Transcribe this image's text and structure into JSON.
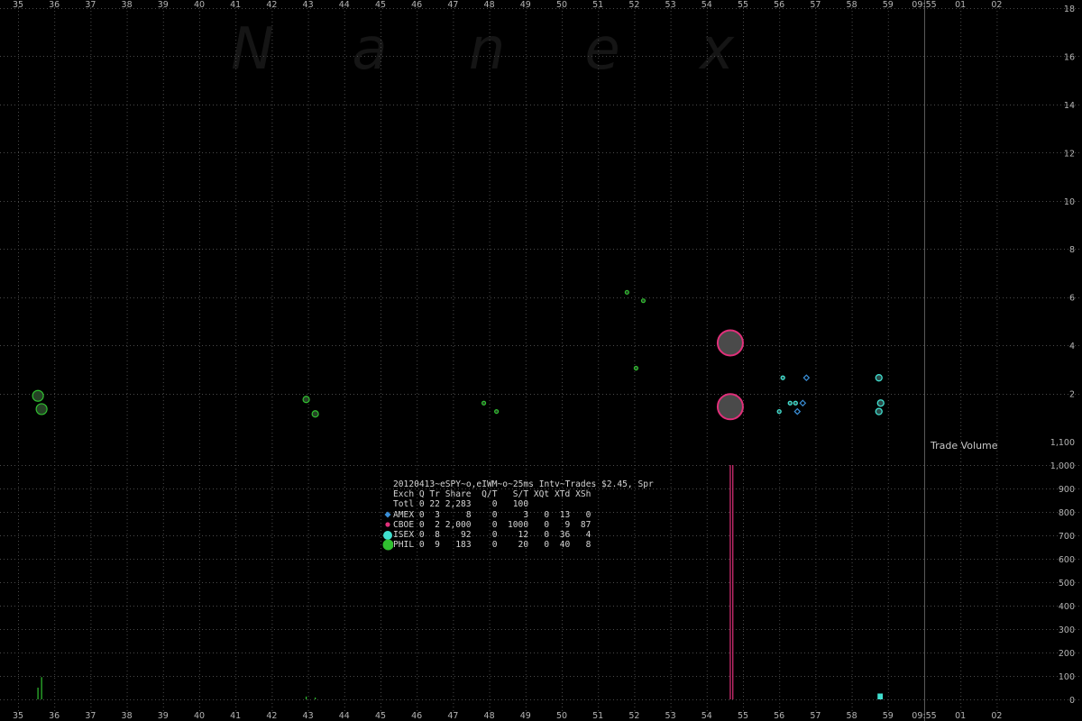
{
  "chart_data": {
    "type": "scatter",
    "title": "20120413~eSPY~o,eIWM~o~25ms Intv~Trades $2.45, Spr",
    "watermark": [
      "N",
      "a",
      "n",
      "e",
      "x"
    ],
    "x_axis": {
      "start_second": 34.5,
      "end_second": 122.5,
      "labels": [
        "35",
        "36",
        "37",
        "38",
        "39",
        "40",
        "41",
        "42",
        "43",
        "44",
        "45",
        "46",
        "47",
        "48",
        "49",
        "50",
        "51",
        "52",
        "53",
        "54",
        "55",
        "56",
        "57",
        "58",
        "59",
        "09:55",
        "01",
        "02"
      ],
      "label_seconds": [
        35,
        36,
        37,
        38,
        39,
        40,
        41,
        42,
        43,
        44,
        45,
        46,
        47,
        48,
        49,
        50,
        51,
        52,
        53,
        54,
        55,
        56,
        57,
        58,
        59,
        60,
        61,
        62
      ],
      "minute_divider_second": 60
    },
    "price_axis": {
      "min": 0,
      "max": 18,
      "ticks": [
        2,
        4,
        6,
        8,
        10,
        12,
        14,
        16,
        18
      ]
    },
    "volume_axis": {
      "label": "Trade Volume",
      "min": 0,
      "max": 1000,
      "ticks": [
        0,
        100,
        200,
        300,
        400,
        500,
        600,
        700,
        800,
        900,
        1000
      ],
      "tick_labels": [
        "0",
        "100",
        "200",
        "300",
        "400",
        "500",
        "600",
        "700",
        "800",
        "900",
        "1,000",
        "1,100"
      ]
    },
    "colors": {
      "AMEX": "#3a8fd8",
      "CBOE": "#e0307a",
      "ISEX": "#40e0d0",
      "PHIL": "#30c030",
      "bubble_fill": "#4a4a4a",
      "grid": "#4a4a4a",
      "tick_text": "#b4b4b4"
    },
    "trades": [
      {
        "t": 35.55,
        "price": 1.9,
        "size": "medium",
        "exch": "PHIL"
      },
      {
        "t": 35.65,
        "price": 1.35,
        "size": "medium",
        "exch": "PHIL"
      },
      {
        "t": 42.95,
        "price": 1.75,
        "size": "small",
        "exch": "PHIL"
      },
      {
        "t": 43.2,
        "price": 1.15,
        "size": "small",
        "exch": "PHIL"
      },
      {
        "t": 47.85,
        "price": 1.6,
        "size": "tiny",
        "exch": "PHIL"
      },
      {
        "t": 48.2,
        "price": 1.25,
        "size": "tiny",
        "exch": "PHIL"
      },
      {
        "t": 51.8,
        "price": 6.2,
        "size": "tiny",
        "exch": "PHIL"
      },
      {
        "t": 52.05,
        "price": 3.05,
        "size": "tiny",
        "exch": "PHIL"
      },
      {
        "t": 52.25,
        "price": 5.85,
        "size": "tiny",
        "exch": "PHIL"
      },
      {
        "t": 54.65,
        "price": 4.1,
        "size": "xlarge",
        "exch": "CBOE"
      },
      {
        "t": 54.65,
        "price": 1.45,
        "size": "xlarge",
        "exch": "CBOE"
      },
      {
        "t": 56.1,
        "price": 2.65,
        "size": "tiny",
        "exch": "ISEX"
      },
      {
        "t": 56.0,
        "price": 1.25,
        "size": "tiny",
        "exch": "ISEX"
      },
      {
        "t": 56.3,
        "price": 1.6,
        "size": "tiny",
        "exch": "ISEX"
      },
      {
        "t": 56.45,
        "price": 1.6,
        "size": "tiny",
        "exch": "ISEX"
      },
      {
        "t": 56.5,
        "price": 1.25,
        "size": "tiny",
        "exch": "AMEX"
      },
      {
        "t": 56.65,
        "price": 1.6,
        "size": "tiny",
        "exch": "AMEX"
      },
      {
        "t": 56.75,
        "price": 2.65,
        "size": "tiny",
        "exch": "AMEX"
      },
      {
        "t": 58.75,
        "price": 2.65,
        "size": "small",
        "exch": "ISEX"
      },
      {
        "t": 58.8,
        "price": 1.6,
        "size": "small",
        "exch": "ISEX"
      },
      {
        "t": 58.75,
        "price": 1.25,
        "size": "small",
        "exch": "ISEX"
      }
    ],
    "volume_bars": [
      {
        "t": 35.55,
        "volume": 50,
        "exch": "PHIL"
      },
      {
        "t": 35.65,
        "volume": 95,
        "exch": "PHIL"
      },
      {
        "t": 42.95,
        "volume": 12,
        "exch": "PHIL"
      },
      {
        "t": 43.2,
        "volume": 8,
        "exch": "PHIL"
      },
      {
        "t": 54.65,
        "volume": 1000,
        "exch": "CBOE"
      },
      {
        "t": 54.72,
        "volume": 1000,
        "exch": "CBOE"
      },
      {
        "t": 58.75,
        "volume": 25,
        "exch": "ISEX"
      },
      {
        "t": 58.82,
        "volume": 25,
        "exch": "ISEX"
      }
    ]
  },
  "stats": {
    "title": "20120413~eSPY~o,eIWM~o~25ms Intv~Trades $2.45, Spr",
    "header": [
      "Exch",
      "Q",
      "Tr",
      "Share",
      "Q/T",
      "S/T",
      "XQt",
      "XTd",
      "XSh"
    ],
    "rows": [
      {
        "marker": "none",
        "cells": [
          "Totl",
          "0",
          "22",
          "2,283",
          "0",
          "100",
          "",
          "",
          ""
        ]
      },
      {
        "marker": "AMEX",
        "cells": [
          "AMEX",
          "0",
          "3",
          "8",
          "0",
          "3",
          "0",
          "13",
          "0"
        ]
      },
      {
        "marker": "CBOE",
        "cells": [
          "CBOE",
          "0",
          "2",
          "2,000",
          "0",
          "1000",
          "0",
          "9",
          "87"
        ]
      },
      {
        "marker": "ISEX",
        "cells": [
          "ISEX",
          "0",
          "8",
          "92",
          "0",
          "12",
          "0",
          "36",
          "4"
        ]
      },
      {
        "marker": "PHIL",
        "cells": [
          "PHIL",
          "0",
          "9",
          "183",
          "0",
          "20",
          "0",
          "40",
          "8"
        ]
      }
    ]
  }
}
